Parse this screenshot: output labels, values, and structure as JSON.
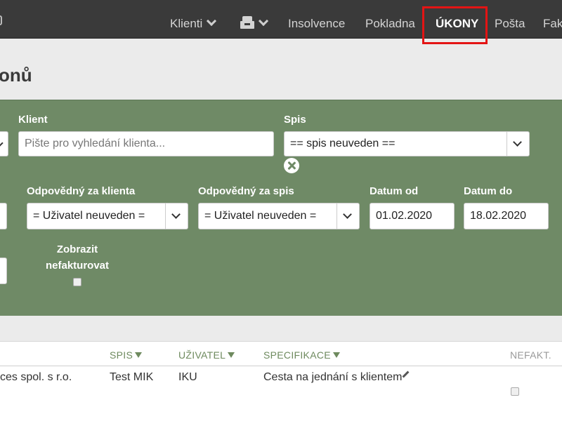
{
  "nav": {
    "items": [
      {
        "label": "Klienti"
      },
      {
        "label": "Insolvence"
      },
      {
        "label": "Pokladna"
      },
      {
        "label": "ÚKONY"
      },
      {
        "label": "Pošta"
      },
      {
        "label": "Fak"
      }
    ],
    "inbox_icon": "inbox-icon"
  },
  "page": {
    "title": "onů"
  },
  "filters": {
    "klient": {
      "label": "Klient",
      "placeholder": "Pište pro vyhledání klienta..."
    },
    "spis": {
      "label": "Spis",
      "value": "== spis neuveden =="
    },
    "odpovedny_klient": {
      "label": "Odpovědný za klienta",
      "value": "= Uživatel neuveden ="
    },
    "odpovedny_spis": {
      "label": "Odpovědný za spis",
      "value": "= Uživatel neuveden ="
    },
    "datum_od": {
      "label": "Datum od",
      "value": "01.02.2020"
    },
    "datum_do": {
      "label": "Datum do",
      "value": "18.02.2020"
    },
    "nefakturovat": {
      "label": "Zobrazit nefakturovat",
      "checked": false
    }
  },
  "table": {
    "headers": {
      "spis": "SPIS",
      "uzivatel": "UŽIVATEL",
      "specifikace": "SPECIFIKACE",
      "nefakt": "NEFAKT."
    },
    "rows": [
      {
        "klient": "ces spol. s r.o.",
        "spis": "Test MIK",
        "uzivatel": "IKU",
        "specifikace": "Cesta na jednání s klientem",
        "nefakt": false
      }
    ]
  },
  "colors": {
    "nav_bg": "#3a3a3a",
    "panel_bg": "#6f8a66",
    "accent_green": "#6e8a5e",
    "highlight_red": "#e31414"
  }
}
